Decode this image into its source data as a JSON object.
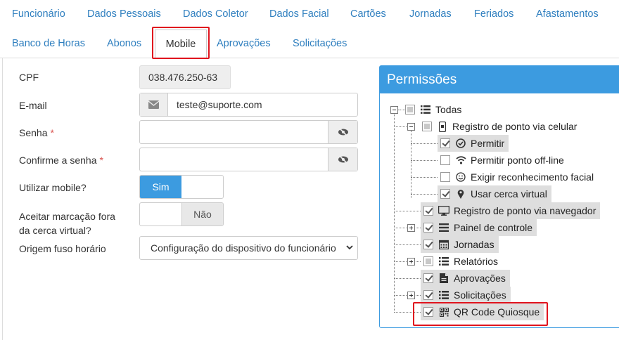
{
  "tabs": [
    {
      "label": "Funcionário"
    },
    {
      "label": "Dados Pessoais"
    },
    {
      "label": "Dados Coletor"
    },
    {
      "label": "Dados Facial"
    },
    {
      "label": "Cartões"
    },
    {
      "label": "Jornadas"
    },
    {
      "label": "Feriados"
    },
    {
      "label": "Afastamentos"
    },
    {
      "label": "Banco de Horas"
    },
    {
      "label": "Abonos"
    },
    {
      "label": "Mobile"
    },
    {
      "label": "Aprovações"
    },
    {
      "label": "Solicitações"
    }
  ],
  "active_tab": "Mobile",
  "form": {
    "cpf_label": "CPF",
    "cpf_value": "038.476.250-63",
    "email_label": "E-mail",
    "email_value": "teste@suporte.com",
    "senha_label": "Senha",
    "confirm_label": "Confirme a senha",
    "required_mark": "*",
    "mobile_label": "Utilizar mobile?",
    "mobile_on": "Sim",
    "fora_label_line1": "Aceitar marcação fora",
    "fora_label_line2": "da cerca virtual?",
    "fora_off": "Não",
    "fuso_label": "Origem fuso horário",
    "fuso_value": "Configuração do dispositivo do funcionário"
  },
  "permissions": {
    "title": "Permissões",
    "nodes": [
      {
        "label": "Todas",
        "icon": "list-icon",
        "state": "partial"
      },
      {
        "label": "Registro de ponto via celular",
        "icon": "mobile-icon",
        "state": "partial"
      },
      {
        "label": "Permitir",
        "icon": "check-circle-icon",
        "state": "checked"
      },
      {
        "label": "Permitir ponto off-line",
        "icon": "wifi-icon",
        "state": "unchecked"
      },
      {
        "label": "Exigir reconhecimento facial",
        "icon": "smile-icon",
        "state": "unchecked"
      },
      {
        "label": "Usar cerca virtual",
        "icon": "map-marker-icon",
        "state": "checked"
      },
      {
        "label": "Registro de ponto via navegador",
        "icon": "desktop-icon",
        "state": "checked"
      },
      {
        "label": "Painel de controle",
        "icon": "bars-icon",
        "state": "checked"
      },
      {
        "label": "Jornadas",
        "icon": "calendar-icon",
        "state": "checked"
      },
      {
        "label": "Relatórios",
        "icon": "list-icon",
        "state": "partial"
      },
      {
        "label": "Aprovações",
        "icon": "file-icon",
        "state": "checked"
      },
      {
        "label": "Solicitações",
        "icon": "list-icon",
        "state": "checked"
      },
      {
        "label": "QR Code Quiosque",
        "icon": "qrcode-icon",
        "state": "checked"
      }
    ]
  },
  "colors": {
    "link": "#2f7fbf",
    "accent": "#3c9be0",
    "highlight": "#e0141e",
    "required": "#d9534f"
  }
}
